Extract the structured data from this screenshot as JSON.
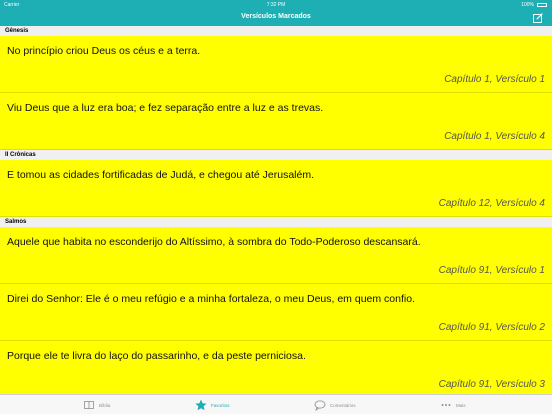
{
  "status": {
    "carrier": "Carrier",
    "time": "7:32 PM",
    "battery": "100%"
  },
  "nav": {
    "title": "Versículos Marcados"
  },
  "sections": [
    {
      "name": "Gênesis",
      "verses": [
        {
          "text": "No princípio criou Deus os céus e a terra.",
          "ref": "Capítulo 1, Versículo 1"
        },
        {
          "text": "Viu Deus que a luz era boa; e fez separação entre a luz e as trevas.",
          "ref": "Capítulo 1, Versículo 4"
        }
      ]
    },
    {
      "name": "II Crônicas",
      "verses": [
        {
          "text": "E tomou as cidades fortificadas de Judá, e chegou até Jerusalém.",
          "ref": "Capítulo 12, Versículo 4"
        }
      ]
    },
    {
      "name": "Salmos",
      "verses": [
        {
          "text": "Aquele que habita no esconderijo do Altíssimo, à sombra do Todo-Poderoso descansará.",
          "ref": "Capítulo 91, Versículo 1"
        },
        {
          "text": "Direi do Senhor: Ele é o meu refúgio e a minha fortaleza, o meu Deus, em quem confio.",
          "ref": "Capítulo 91, Versículo 2"
        },
        {
          "text": "Porque ele te livra do laço do passarinho, e da peste perniciosa.",
          "ref": "Capítulo 91, Versículo 3"
        }
      ]
    }
  ],
  "tabs": [
    {
      "label": "Bíblia",
      "icon": "book-icon"
    },
    {
      "label": "Favoritos",
      "icon": "star-icon"
    },
    {
      "label": "Comentários",
      "icon": "speech-bubble-icon"
    },
    {
      "label": "Mais",
      "icon": "more-dots-icon"
    }
  ],
  "colors": {
    "accent": "#1dafb4",
    "verse_background": "#ffff00",
    "section_background": "#f0f0f0",
    "tab_inactive": "#8e8e93"
  }
}
